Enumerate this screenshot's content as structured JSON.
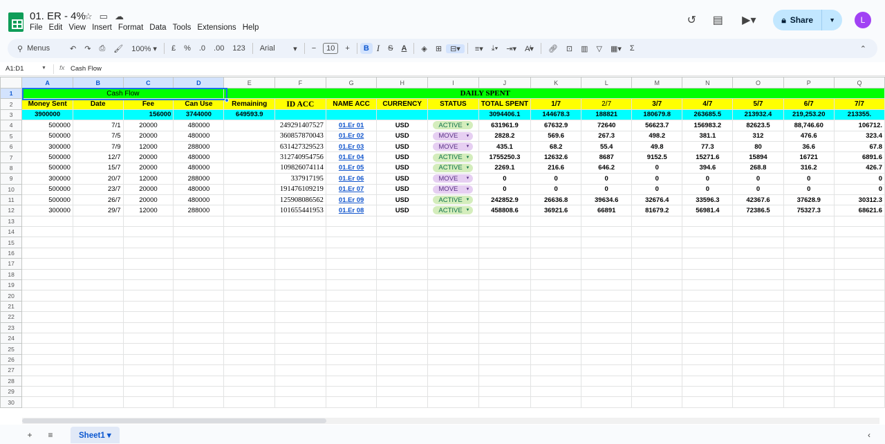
{
  "doc": {
    "title": "01. ER - 4%"
  },
  "menu": [
    "File",
    "Edit",
    "View",
    "Insert",
    "Format",
    "Data",
    "Tools",
    "Extensions",
    "Help"
  ],
  "header": {
    "share_label": "Share",
    "avatar_initial": "L"
  },
  "toolbar": {
    "search_label": "Menus",
    "zoom": "100%",
    "currency": "£",
    "percent": "%",
    "dec_decrease": ".0",
    "dec_increase": ".00",
    "number_format": "123",
    "font": "Arial",
    "font_size": "10",
    "bold": "B",
    "italic": "I",
    "strike": "S",
    "text_color": "A"
  },
  "formula": {
    "name_box": "A1:D1",
    "fx": "fx",
    "value": "Cash Flow"
  },
  "columns": [
    "A",
    "B",
    "C",
    "D",
    "E",
    "F",
    "G",
    "H",
    "I",
    "J",
    "K",
    "L",
    "M",
    "N",
    "O",
    "P",
    "Q"
  ],
  "row1": {
    "cash_flow": "Cash Flow",
    "daily_spent": "DAILY SPENT"
  },
  "row2": [
    "Money Sent",
    "Date",
    "Fee",
    "Can Use",
    "Remaining",
    "ID ACC",
    "NAME ACC",
    "CURRENCY",
    "STATUS",
    "TOTAL SPENT",
    "1/7",
    "2/7",
    "3/7",
    "4/7",
    "5/7",
    "6/7",
    "7/7"
  ],
  "row3": {
    "money_sent": "3900000",
    "fee": "156000",
    "can_use": "3744000",
    "remaining": "649593.9",
    "total_spent": "3094406.1",
    "d1": "144678.3",
    "d2": "188821",
    "d3": "180679.8",
    "d4": "263685.5",
    "d5": "213932.4",
    "d6": "219,253.20",
    "d7": "213355."
  },
  "rows": [
    {
      "n": "4",
      "money": "500000",
      "date": "7/1",
      "fee": "20000",
      "can": "480000",
      "id": "249291407527",
      "name": "01.Er 01",
      "cur": "USD",
      "status": "ACTIVE",
      "total": "631961.9",
      "d1": "67632.9",
      "d2": "72640",
      "d3": "56623.7",
      "d4": "156983.2",
      "d5": "82623.5",
      "d6": "88,746.60",
      "d7": "106712."
    },
    {
      "n": "5",
      "money": "500000",
      "date": "7/5",
      "fee": "20000",
      "can": "480000",
      "id": "360857870043",
      "name": "01.Er 02",
      "cur": "USD",
      "status": "MOVE",
      "total": "2828.2",
      "d1": "569.6",
      "d2": "267.3",
      "d3": "498.2",
      "d4": "381.1",
      "d5": "312",
      "d6": "476.6",
      "d7": "323.4"
    },
    {
      "n": "6",
      "money": "300000",
      "date": "7/9",
      "fee": "12000",
      "can": "288000",
      "id": "631427329523",
      "name": "01.Er 03",
      "cur": "USD",
      "status": "MOVE",
      "total": "435.1",
      "d1": "68.2",
      "d2": "55.4",
      "d3": "49.8",
      "d4": "77.3",
      "d5": "80",
      "d6": "36.6",
      "d7": "67.8"
    },
    {
      "n": "7",
      "money": "500000",
      "date": "12/7",
      "fee": "20000",
      "can": "480000",
      "id": "312740954756",
      "name": "01.Er 04",
      "cur": "USD",
      "status": "ACTIVE",
      "total": "1755250.3",
      "d1": "12632.6",
      "d2": "8687",
      "d3": "9152.5",
      "d4": "15271.6",
      "d5": "15894",
      "d6": "16721",
      "d7": "6891.6"
    },
    {
      "n": "8",
      "money": "500000",
      "date": "15/7",
      "fee": "20000",
      "can": "480000",
      "id": "109826074114",
      "name": "01.Er 05",
      "cur": "USD",
      "status": "ACTIVE",
      "total": "2269.1",
      "d1": "216.6",
      "d2": "646.2",
      "d3": "0",
      "d4": "394.6",
      "d5": "268.8",
      "d6": "316.2",
      "d7": "426.7"
    },
    {
      "n": "9",
      "money": "300000",
      "date": "20/7",
      "fee": "12000",
      "can": "288000",
      "id": "337917195",
      "name": "01.Er 06",
      "cur": "USD",
      "status": "MOVE",
      "total": "0",
      "d1": "0",
      "d2": "0",
      "d3": "0",
      "d4": "0",
      "d5": "0",
      "d6": "0",
      "d7": "0"
    },
    {
      "n": "10",
      "money": "500000",
      "date": "23/7",
      "fee": "20000",
      "can": "480000",
      "id": "191476109219",
      "name": "01.Er 07",
      "cur": "USD",
      "status": "MOVE",
      "total": "0",
      "d1": "0",
      "d2": "0",
      "d3": "0",
      "d4": "0",
      "d5": "0",
      "d6": "0",
      "d7": "0"
    },
    {
      "n": "11",
      "money": "500000",
      "date": "26/7",
      "fee": "20000",
      "can": "480000",
      "id": "125908086562",
      "name": "01.Er 09",
      "cur": "USD",
      "status": "ACTIVE",
      "total": "242852.9",
      "d1": "26636.8",
      "d2": "39634.6",
      "d3": "32676.4",
      "d4": "33596.3",
      "d5": "42367.6",
      "d6": "37628.9",
      "d7": "30312.3"
    },
    {
      "n": "12",
      "money": "300000",
      "date": "29/7",
      "fee": "12000",
      "can": "288000",
      "id": "101655441953",
      "name": "01.Er 08",
      "cur": "USD",
      "status": "ACTIVE",
      "total": "458808.6",
      "d1": "36921.6",
      "d2": "66891",
      "d3": "81679.2",
      "d4": "56981.4",
      "d5": "72386.5",
      "d6": "75327.3",
      "d7": "68621.6"
    }
  ],
  "empty_rows": [
    "13",
    "14",
    "15",
    "16",
    "17",
    "18",
    "19",
    "20",
    "21",
    "22",
    "23",
    "24",
    "25",
    "26",
    "27",
    "28",
    "29",
    "30"
  ],
  "sheets": {
    "active": "Sheet1"
  }
}
